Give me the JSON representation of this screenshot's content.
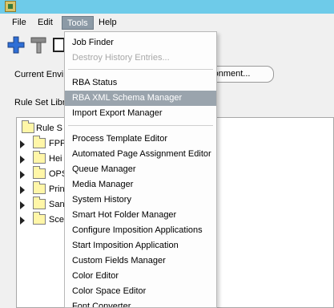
{
  "menubar": {
    "items": [
      {
        "label": "File"
      },
      {
        "label": "Edit"
      },
      {
        "label": "Tools"
      },
      {
        "label": "Help"
      }
    ]
  },
  "toolbar": {
    "icons": [
      "plus-icon",
      "hammer-icon",
      "copy-icon"
    ]
  },
  "env": {
    "label": "Current Envi",
    "button_label": "vironment..."
  },
  "ruleset": {
    "label": "Rule Set Libr"
  },
  "tree": {
    "root": "Rule S",
    "children": [
      {
        "label": "FPP"
      },
      {
        "label": "Hei"
      },
      {
        "label": "OPS"
      },
      {
        "label": "Prin"
      },
      {
        "label": "San"
      },
      {
        "label": "Sce"
      }
    ]
  },
  "tools_menu": {
    "groups": [
      {
        "items": [
          {
            "label": "Job Finder",
            "enabled": true
          },
          {
            "label": "Destroy History Entries...",
            "enabled": false
          }
        ]
      },
      {
        "items": [
          {
            "label": "RBA Status",
            "enabled": true
          },
          {
            "label": "RBA XML Schema Manager",
            "enabled": true,
            "highlighted": true
          },
          {
            "label": "Import Export Manager",
            "enabled": true
          }
        ]
      },
      {
        "items": [
          {
            "label": "Process Template Editor",
            "enabled": true
          },
          {
            "label": "Automated Page Assignment Editor",
            "enabled": true
          },
          {
            "label": "Queue Manager",
            "enabled": true
          },
          {
            "label": "Media Manager",
            "enabled": true
          },
          {
            "label": "System History",
            "enabled": true
          },
          {
            "label": "Smart Hot Folder Manager",
            "enabled": true
          },
          {
            "label": "Configure Imposition Applications",
            "enabled": true
          },
          {
            "label": "Start Imposition Application",
            "enabled": true
          },
          {
            "label": "Custom Fields Manager",
            "enabled": true
          },
          {
            "label": "Color Editor",
            "enabled": true
          },
          {
            "label": "Color Space Editor",
            "enabled": true
          },
          {
            "label": "Font Converter",
            "enabled": true
          }
        ]
      }
    ]
  },
  "colors": {
    "titlebar": "#6ecbe9",
    "menu_active": "#8c9aa6",
    "highlight": "#9aa4ad"
  }
}
